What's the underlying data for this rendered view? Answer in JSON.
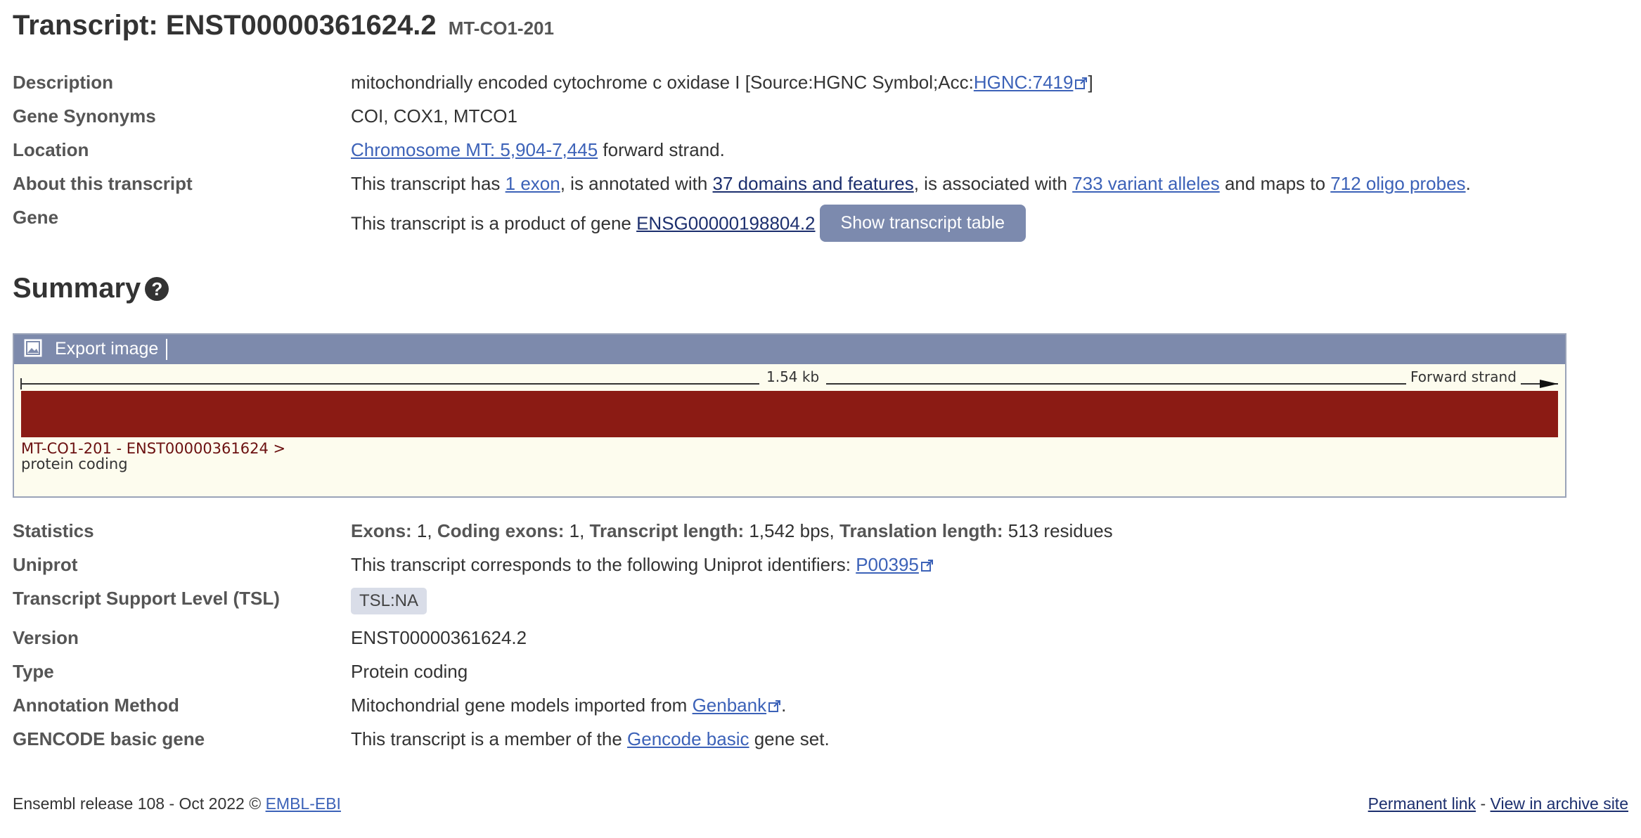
{
  "header": {
    "title": "Transcript: ENST00000361624.2",
    "subtitle": "MT-CO1-201"
  },
  "rows": {
    "description": {
      "label": "Description",
      "text": "mitochondrially encoded cytochrome c oxidase I [Source:HGNC Symbol;Acc:",
      "link": "HGNC:7419",
      "suffix": "]"
    },
    "synonyms": {
      "label": "Gene Synonyms",
      "text": "COI, COX1, MTCO1"
    },
    "location": {
      "label": "Location",
      "link": "Chromosome MT: 5,904-7,445",
      "suffix": " forward strand."
    },
    "about": {
      "label": "About this transcript",
      "t1": "This transcript has ",
      "exon_link": "1 exon",
      "t2": ", is annotated with ",
      "domains_link": "37 domains and features",
      "t3": ", is associated with ",
      "variants_link": "733 variant alleles",
      "t4": " and maps to ",
      "probes_link": "712 oligo probes",
      "t5": "."
    },
    "gene": {
      "label": "Gene",
      "text": "This transcript is a product of gene ",
      "link": "ENSG00000198804.2",
      "button": "Show transcript table"
    }
  },
  "summary": {
    "heading": "Summary",
    "help_icon": "question-circle-icon",
    "toolbar": {
      "export_label": "Export image",
      "icon": "image-icon"
    },
    "track": {
      "scale_label": "1.54 kb",
      "strand_label": "Forward strand",
      "transcript_label": "MT-CO1-201 - ENST00000361624 >",
      "biotype_label": "protein coding",
      "bar_color": "#8b1b14"
    }
  },
  "stats": {
    "label": "Statistics",
    "exons_k": "Exons:",
    "exons_v": " 1, ",
    "coding_k": "Coding exons:",
    "coding_v": " 1, ",
    "length_k": "Transcript length:",
    "length_v": " 1,542 bps, ",
    "translation_k": "Translation length:",
    "translation_v": " 513 residues"
  },
  "uniprot": {
    "label": "Uniprot",
    "text": "This transcript corresponds to the following Uniprot identifiers: ",
    "link": "P00395"
  },
  "tsl": {
    "label": "Transcript Support Level (TSL)",
    "badge": "TSL:NA"
  },
  "version": {
    "label": "Version",
    "text": "ENST00000361624.2"
  },
  "type": {
    "label": "Type",
    "text": "Protein coding"
  },
  "annotation": {
    "label": "Annotation Method",
    "text": "Mitochondrial gene models imported from ",
    "link": "Genbank",
    "suffix": "."
  },
  "gencode": {
    "label": "GENCODE basic gene",
    "text": "This transcript is a member of the ",
    "link": "Gencode basic",
    "suffix": " gene set."
  },
  "footer": {
    "release": "Ensembl release 108 - Oct 2022 © ",
    "org_link": "EMBL-EBI",
    "permanent": "Permanent link",
    "sep": " - ",
    "archive": "View in archive site"
  },
  "colors": {
    "link": "#3c62b8",
    "toolbar": "#7d8aac",
    "button": "#7c8aae"
  }
}
